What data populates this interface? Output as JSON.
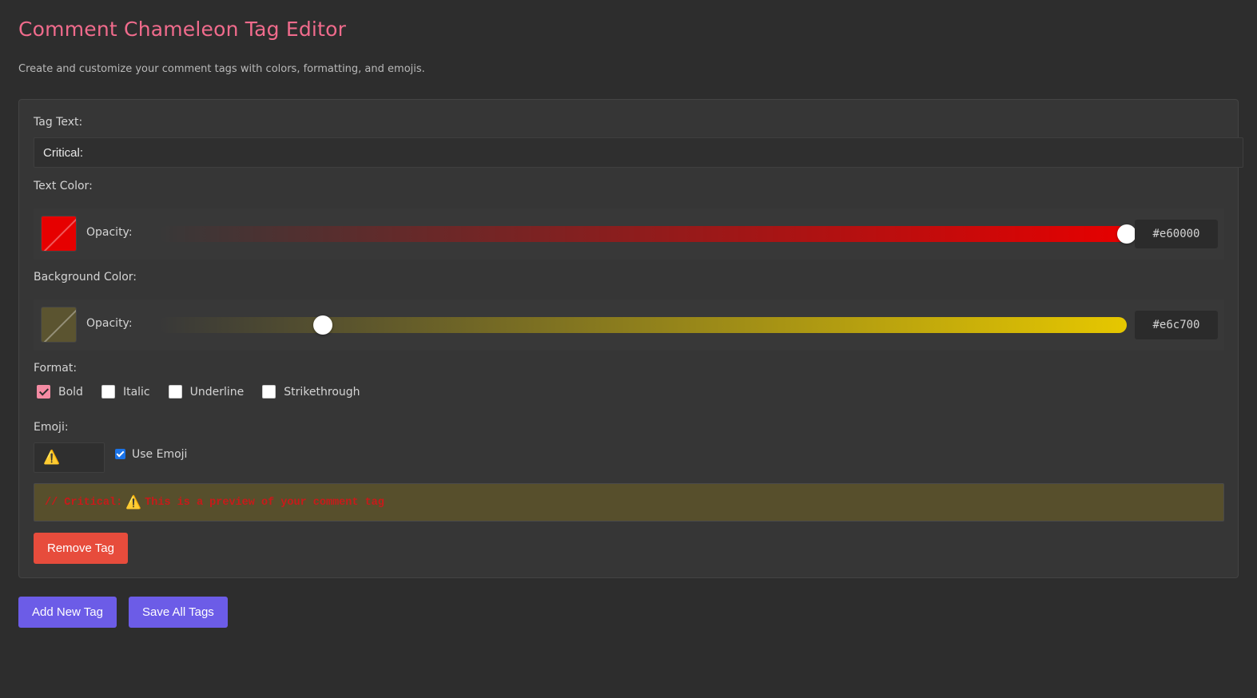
{
  "header": {
    "title": "Comment Chameleon Tag Editor",
    "subtitle": "Create and customize your comment tags with colors, formatting, and emojis."
  },
  "tag": {
    "text_label": "Tag Text:",
    "text_value": "Critical:",
    "text_color": {
      "label": "Text Color:",
      "opacity_label": "Opacity:",
      "hex": "#e60000",
      "opacity": 1.0,
      "swatch": "#e60000"
    },
    "bg_color": {
      "label": "Background Color:",
      "opacity_label": "Opacity:",
      "hex": "#e6c700",
      "opacity": 0.17,
      "swatch": "#5b5430"
    },
    "format": {
      "label": "Format:",
      "options": [
        {
          "label": "Bold",
          "checked": true
        },
        {
          "label": "Italic",
          "checked": false
        },
        {
          "label": "Underline",
          "checked": false
        },
        {
          "label": "Strikethrough",
          "checked": false
        }
      ]
    },
    "emoji": {
      "label": "Emoji:",
      "value": "⚠️",
      "use_label": "Use Emoji",
      "use_checked": true
    },
    "preview": {
      "prefix": "// Critical:",
      "emoji": "⚠️",
      "suffix": "This is a preview of your comment tag"
    },
    "remove_label": "Remove Tag"
  },
  "actions": {
    "add_label": "Add New Tag",
    "save_label": "Save All Tags"
  }
}
